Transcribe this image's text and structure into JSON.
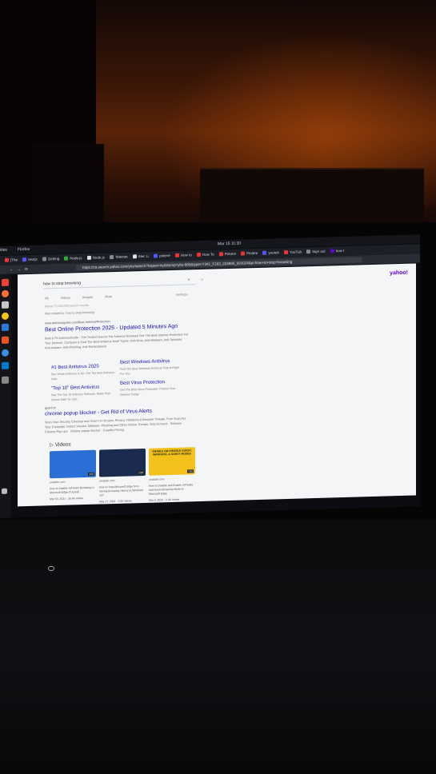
{
  "topbar": {
    "activities": "ities",
    "app": "Firefox",
    "clock": "Mar 15 11:30"
  },
  "tabs": [
    {
      "label": "[The",
      "color": "#e33"
    },
    {
      "label": "nextjs",
      "color": "#55f"
    },
    {
      "label": "Getting",
      "color": "#888"
    },
    {
      "label": "Node.js",
      "color": "#3a3"
    },
    {
      "label": "Node.js",
      "color": "#ddd"
    },
    {
      "label": "Telemet",
      "color": "#888"
    },
    {
      "label": "Alec Li",
      "color": "#ddd"
    },
    {
      "label": "pintere",
      "color": "#55f"
    },
    {
      "label": "How to",
      "color": "#e33"
    },
    {
      "label": "How To",
      "color": "#e33"
    },
    {
      "label": "Pintere",
      "color": "#e33"
    },
    {
      "label": "Pintere",
      "color": "#e33"
    },
    {
      "label": "youtub",
      "color": "#55f"
    },
    {
      "label": "YouTub",
      "color": "#e33"
    },
    {
      "label": "Sign out",
      "color": "#888"
    },
    {
      "label": "how t",
      "color": "#6001d2"
    }
  ],
  "address_bar": {
    "url": "https://ca.search.yahoo.com/yhs/search?hspart=iry&hsimp=yhs-880&type=Y341_F163_224880_091024&p=how+to+stop+browsing"
  },
  "search": {
    "query": "how to stop browsing",
    "clear": "✕",
    "submit": "⌕",
    "logo": "yahoo!",
    "filters": [
      "All",
      "Videos",
      "Images",
      "More"
    ],
    "settings": "Settings",
    "count": "About 77,100,000 search results",
    "also_try": "Also related to: how to stop browsing"
  },
  "ad1": {
    "url": "www.antivirusguide.com/Best-Internet/Protection",
    "title": "Best Online Protection 2025 - Updated 5 Minutes Ago",
    "desc": "Best & Fit AntivirusGuide - The Trusted Source For Antivirus Reviews! Get The Best Internet Protection For Your Devices. Compare & Find The Best Antivirus Now! Types: Anti-Virus, Anti-Malware, Anti-Spyware, Anti-Adware, Anti-Phishing, Anti-Ransomware.",
    "sublinks": [
      {
        "title": "#1 Best Antivirus 2025",
        "desc": "See Which Antivirus Is Up. Get The Best Antivirus Now"
      },
      {
        "title": "Best Windows Antivirus",
        "desc": "Find The Best Windows Antivirus That Is Right For You"
      },
      {
        "title": "\"Top 10\" Best Antivirus",
        "desc": "See The Top 10 Antivirus Software. Make Your Device Safe To Use!"
      },
      {
        "title": "Best Virus Protection",
        "desc": "Get The Best Virus Protection. Protect Your Devices Today!"
      }
    ]
  },
  "ad2": {
    "url": "guard.io",
    "title": "chrome popup blocker - Get Rid of Virus Alerts",
    "desc": "Scan Your Security Checkup and Scan For Viruses, Privacy Violations & Browser Threats. Free Scan For Your Computer. Detect Viruses, Malware, Phishing and Other Online Threats. Stop Account · Remove Chrome Pop ups · chrome popup blocker · Guardio Pricing"
  },
  "videos": {
    "heading": "Videos",
    "items": [
      {
        "source": "youtube.com",
        "title": "How to Disable InPrivate Browsing in Microsoft Edge (Tutorial)",
        "meta": "Mar 19, 2021 · 26.6K Views",
        "duration": "3:00",
        "color": "#2a6fd6"
      },
      {
        "source": "youtube.com",
        "title": "How to Stop Microsoft Edge from Saving Browsing History in Windows 10?",
        "meta": "May 17, 2021 · 3.5K Views",
        "duration": "1:00",
        "color": "#1b2b50"
      },
      {
        "source": "youtube.com",
        "title": "How to Disable and Enable InPrivate and Guest Browsing Mode in Microsoft Edge",
        "meta": "Mar 9, 2022 · 2.4K Views",
        "duration": "4:30",
        "color": "#f2c21a",
        "caption": "ENABLE OR DISABLE GUEST, INPRIVATE, & GUEST MODES"
      }
    ]
  }
}
